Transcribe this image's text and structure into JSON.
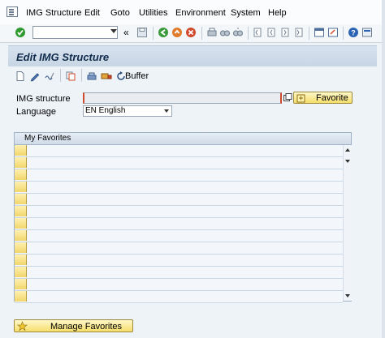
{
  "menu": {
    "items": [
      "IMG Structure",
      "Edit",
      "Goto",
      "Utilities",
      "Environment",
      "System",
      "Help"
    ]
  },
  "toolbar": {
    "command_value": "",
    "icons": [
      "check-icon",
      "back-icon",
      "exit-icon",
      "cancel-icon",
      "save-icon",
      "print-icon",
      "find-icon",
      "find-next-icon",
      "first-page-icon",
      "prev-page-icon",
      "next-page-icon",
      "last-page-icon",
      "new-session-icon",
      "shortcut-icon",
      "help-icon",
      "layout-icon"
    ],
    "colors": {
      "check": "#2f9a2f",
      "back": "#3b9a3b",
      "exit": "#e07b2c",
      "cancel": "#d24a2c"
    }
  },
  "page": {
    "title": "Edit IMG Structure",
    "app_toolbar": {
      "buffer_label": "Buffer"
    }
  },
  "form": {
    "img_structure_label": "IMG structure",
    "img_structure_value": "",
    "language_label": "Language",
    "language_value": "EN English",
    "favorite_button": "Favorite"
  },
  "favorites": {
    "header": "My Favorites",
    "rows": [
      "",
      "",
      "",
      "",
      "",
      "",
      "",
      "",
      "",
      "",
      "",
      "",
      ""
    ]
  },
  "footer": {
    "manage_button": "Manage Favorites"
  }
}
